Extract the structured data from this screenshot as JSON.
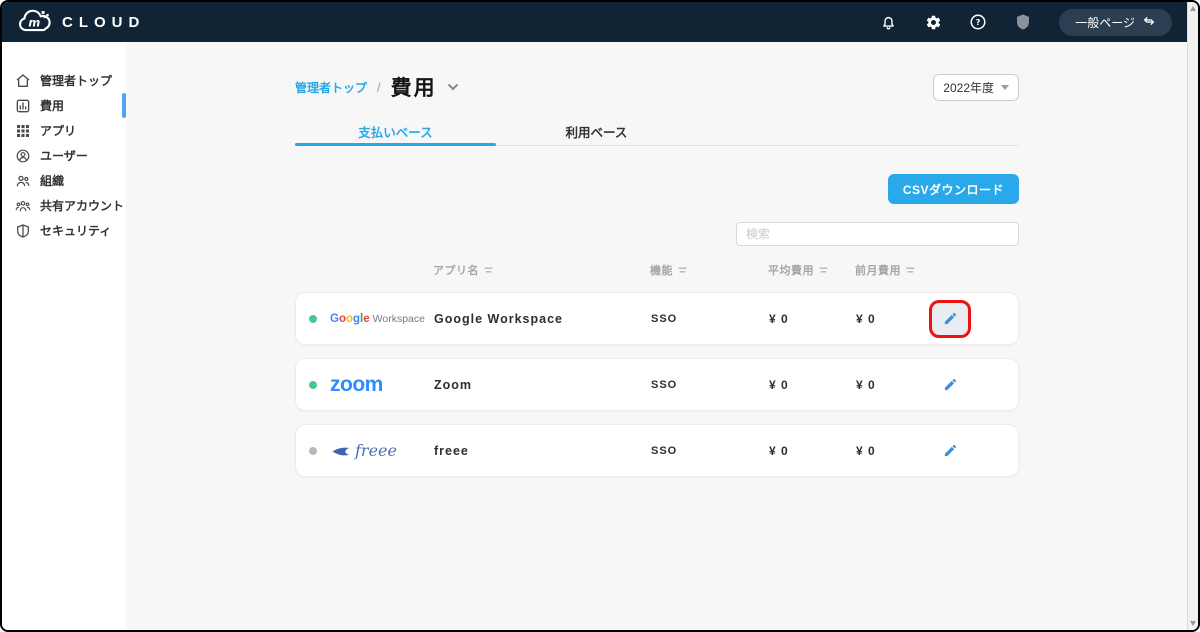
{
  "topbar": {
    "logo_text": "CLOUD",
    "page_switch_label": "一般ページ"
  },
  "sidebar": {
    "items": [
      {
        "label": "管理者トップ",
        "active": false
      },
      {
        "label": "費用",
        "active": true
      },
      {
        "label": "アプリ",
        "active": false
      },
      {
        "label": "ユーザー",
        "active": false
      },
      {
        "label": "組織",
        "active": false
      },
      {
        "label": "共有アカウント",
        "active": false
      },
      {
        "label": "セキュリティ",
        "active": false
      }
    ]
  },
  "main": {
    "breadcrumb": {
      "parent": "管理者トップ",
      "separator": "/",
      "current": "費用"
    },
    "year_select": "2022年度",
    "tabs": [
      {
        "label": "支払いベース",
        "active": true
      },
      {
        "label": "利用ベース",
        "active": false
      }
    ],
    "csv_button": "CSVダウンロード",
    "search_placeholder": "検索",
    "logos": {
      "google_letters": [
        "G",
        "o",
        "o",
        "g",
        "l",
        "e"
      ],
      "google_colors": [
        "#4285F4",
        "#EA4335",
        "#FBBC05",
        "#4285F4",
        "#34A853",
        "#EA4335"
      ],
      "google_suffix": "Workspace",
      "zoom_text": "zoom",
      "freee_text": "freee"
    },
    "table": {
      "headers": [
        "アプリ名",
        "機能",
        "平均費用",
        "前月費用"
      ],
      "rows": [
        {
          "app": "Google Workspace",
          "logo": "google",
          "status": "active",
          "function": "SSO",
          "avg_cost": "¥ 0",
          "prev_cost": "¥ 0",
          "highlighted": true
        },
        {
          "app": "Zoom",
          "logo": "zoom",
          "status": "active",
          "function": "SSO",
          "avg_cost": "¥ 0",
          "prev_cost": "¥ 0",
          "highlighted": false
        },
        {
          "app": "freee",
          "logo": "freee",
          "status": "inactive",
          "function": "SSO",
          "avg_cost": "¥ 0",
          "prev_cost": "¥ 0",
          "highlighted": false
        }
      ]
    }
  },
  "colors": {
    "accent_blue": "#2aa7e8",
    "topbar_navy": "#112436",
    "annotation_red": "#ea1212",
    "status_green": "#4cc790",
    "status_gray": "#b9b9b9",
    "pencil_blue": "#3f8fd8"
  }
}
